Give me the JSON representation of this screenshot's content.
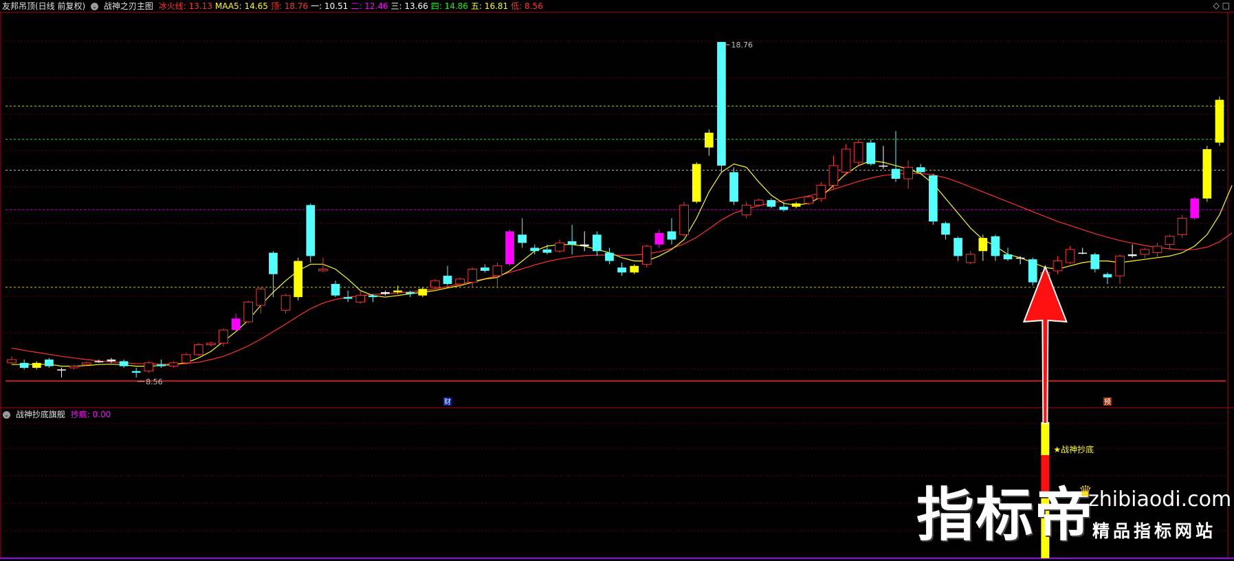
{
  "main_header": {
    "stock_name": "友邦吊顶(日线 前复权)",
    "indicator": "战神之刃主图",
    "lines": [
      {
        "label": "冰火线:",
        "value": "13.13",
        "color": "#ff3030"
      },
      {
        "label": "MAA5:",
        "value": "14.65",
        "color": "#ffff00"
      },
      {
        "label": "顶:",
        "value": "18.76",
        "color": "#ff3030"
      },
      {
        "label": "一:",
        "value": "10.51",
        "color": "#ffffff"
      },
      {
        "label": "二:",
        "value": "12.46",
        "color": "#ff00ff"
      },
      {
        "label": "三:",
        "value": "13.66",
        "color": "#ffffff"
      },
      {
        "label": "四:",
        "value": "14.86",
        "color": "#00ff00"
      },
      {
        "label": "五:",
        "value": "16.81",
        "color": "#ffff00"
      },
      {
        "label": "低:",
        "value": "8.56",
        "color": "#ff3030"
      }
    ]
  },
  "sub_header": {
    "indicator": "战神抄底旗舰",
    "signal_label": "抄底:",
    "signal_value": "0.00"
  },
  "top_right_icons": [
    "diamond-icon",
    "square-icon"
  ],
  "chart_data": {
    "type": "candlestick",
    "ylim": [
      7.7,
      19.2
    ],
    "candles": [
      {
        "o": 9.1,
        "h": 9.2,
        "l": 8.95,
        "c": 9.0,
        "k": "r"
      },
      {
        "o": 9.0,
        "h": 9.1,
        "l": 8.8,
        "c": 8.85,
        "k": "c"
      },
      {
        "o": 8.85,
        "h": 9.05,
        "l": 8.8,
        "c": 9.0,
        "k": "y"
      },
      {
        "o": 9.1,
        "h": 9.15,
        "l": 8.85,
        "c": 8.9,
        "k": "c"
      },
      {
        "o": 8.8,
        "h": 8.85,
        "l": 8.56,
        "c": 8.78,
        "k": "w"
      },
      {
        "o": 8.85,
        "h": 8.95,
        "l": 8.8,
        "c": 8.9,
        "k": "r"
      },
      {
        "o": 8.95,
        "h": 9.05,
        "l": 8.9,
        "c": 9.0,
        "k": "r"
      },
      {
        "o": 9.05,
        "h": 9.1,
        "l": 9.0,
        "c": 9.05,
        "k": "w"
      },
      {
        "o": 9.05,
        "h": 9.15,
        "l": 9.0,
        "c": 9.1,
        "k": "w"
      },
      {
        "o": 9.05,
        "h": 9.1,
        "l": 8.85,
        "c": 8.9,
        "k": "c"
      },
      {
        "o": 8.75,
        "h": 8.85,
        "l": 8.56,
        "c": 8.7,
        "k": "c"
      },
      {
        "o": 8.75,
        "h": 9.05,
        "l": 8.7,
        "c": 9.0,
        "k": "r"
      },
      {
        "o": 8.95,
        "h": 9.1,
        "l": 8.85,
        "c": 8.9,
        "k": "c"
      },
      {
        "o": 8.9,
        "h": 9.05,
        "l": 8.85,
        "c": 9.0,
        "k": "r"
      },
      {
        "o": 9.0,
        "h": 9.3,
        "l": 8.95,
        "c": 9.25,
        "k": "r"
      },
      {
        "o": 9.25,
        "h": 9.6,
        "l": 9.2,
        "c": 9.55,
        "k": "r"
      },
      {
        "o": 9.55,
        "h": 9.65,
        "l": 9.5,
        "c": 9.6,
        "k": "r"
      },
      {
        "o": 9.6,
        "h": 10.05,
        "l": 9.5,
        "c": 10.0,
        "k": "r"
      },
      {
        "o": 10.35,
        "h": 10.5,
        "l": 9.95,
        "c": 10.0,
        "k": "m"
      },
      {
        "o": 10.25,
        "h": 10.9,
        "l": 10.2,
        "c": 10.85,
        "k": "r"
      },
      {
        "o": 10.75,
        "h": 11.3,
        "l": 10.5,
        "c": 11.25,
        "k": "r"
      },
      {
        "o": 12.35,
        "h": 12.4,
        "l": 11.0,
        "c": 11.7,
        "k": "c"
      },
      {
        "o": 10.6,
        "h": 11.1,
        "l": 10.5,
        "c": 11.05,
        "k": "r"
      },
      {
        "o": 11.0,
        "h": 12.2,
        "l": 10.9,
        "c": 12.1,
        "k": "y"
      },
      {
        "o": 13.8,
        "h": 13.85,
        "l": 12.05,
        "c": 12.25,
        "k": "c"
      },
      {
        "o": 11.8,
        "h": 12.2,
        "l": 11.75,
        "c": 11.85,
        "k": "r"
      },
      {
        "o": 11.4,
        "h": 11.5,
        "l": 11.0,
        "c": 11.05,
        "k": "c"
      },
      {
        "o": 11.0,
        "h": 11.2,
        "l": 10.85,
        "c": 10.95,
        "k": "c"
      },
      {
        "o": 10.85,
        "h": 11.2,
        "l": 10.8,
        "c": 11.05,
        "k": "r"
      },
      {
        "o": 11.05,
        "h": 11.1,
        "l": 10.85,
        "c": 11.0,
        "k": "c"
      },
      {
        "o": 11.1,
        "h": 11.2,
        "l": 11.05,
        "c": 11.15,
        "k": "w"
      },
      {
        "o": 11.15,
        "h": 11.35,
        "l": 11.1,
        "c": 11.2,
        "k": "y"
      },
      {
        "o": 11.15,
        "h": 11.2,
        "l": 11.0,
        "c": 11.1,
        "k": "c"
      },
      {
        "o": 11.05,
        "h": 11.3,
        "l": 11.0,
        "c": 11.25,
        "k": "y"
      },
      {
        "o": 11.3,
        "h": 11.55,
        "l": 11.25,
        "c": 11.5,
        "k": "r"
      },
      {
        "o": 11.65,
        "h": 11.95,
        "l": 11.35,
        "c": 11.4,
        "k": "c"
      },
      {
        "o": 11.4,
        "h": 11.6,
        "l": 11.3,
        "c": 11.55,
        "k": "r"
      },
      {
        "o": 11.45,
        "h": 11.9,
        "l": 11.3,
        "c": 11.85,
        "k": "r"
      },
      {
        "o": 11.9,
        "h": 12.0,
        "l": 11.75,
        "c": 11.8,
        "k": "c"
      },
      {
        "o": 11.65,
        "h": 12.05,
        "l": 11.3,
        "c": 11.95,
        "k": "r"
      },
      {
        "o": 13.0,
        "h": 13.05,
        "l": 11.95,
        "c": 12.0,
        "k": "m"
      },
      {
        "o": 12.9,
        "h": 13.4,
        "l": 12.5,
        "c": 12.65,
        "k": "c"
      },
      {
        "o": 12.4,
        "h": 12.6,
        "l": 12.3,
        "c": 12.5,
        "k": "c"
      },
      {
        "o": 12.45,
        "h": 12.6,
        "l": 12.3,
        "c": 12.35,
        "k": "c"
      },
      {
        "o": 12.4,
        "h": 12.75,
        "l": 12.35,
        "c": 12.65,
        "k": "r"
      },
      {
        "o": 12.7,
        "h": 13.2,
        "l": 12.3,
        "c": 12.6,
        "k": "c"
      },
      {
        "o": 12.55,
        "h": 13.0,
        "l": 12.4,
        "c": 12.6,
        "k": "w"
      },
      {
        "o": 12.9,
        "h": 13.0,
        "l": 12.25,
        "c": 12.4,
        "k": "c"
      },
      {
        "o": 12.35,
        "h": 12.5,
        "l": 12.0,
        "c": 12.1,
        "k": "c"
      },
      {
        "o": 11.9,
        "h": 12.05,
        "l": 11.65,
        "c": 11.75,
        "k": "c"
      },
      {
        "o": 11.75,
        "h": 12.0,
        "l": 11.7,
        "c": 11.95,
        "k": "y"
      },
      {
        "o": 12.0,
        "h": 12.6,
        "l": 11.9,
        "c": 12.55,
        "k": "r"
      },
      {
        "o": 12.6,
        "h": 13.05,
        "l": 12.5,
        "c": 12.95,
        "k": "m"
      },
      {
        "o": 12.75,
        "h": 13.4,
        "l": 12.6,
        "c": 13.0,
        "k": "c"
      },
      {
        "o": 12.9,
        "h": 13.9,
        "l": 12.85,
        "c": 13.8,
        "k": "r"
      },
      {
        "o": 13.9,
        "h": 15.1,
        "l": 13.85,
        "c": 15.05,
        "k": "y"
      },
      {
        "o": 16.0,
        "h": 16.1,
        "l": 15.3,
        "c": 15.55,
        "k": "y"
      },
      {
        "o": 18.76,
        "h": 18.76,
        "l": 14.8,
        "c": 15.0,
        "k": "c"
      },
      {
        "o": 14.8,
        "h": 14.95,
        "l": 13.8,
        "c": 13.9,
        "k": "c"
      },
      {
        "o": 13.5,
        "h": 13.9,
        "l": 13.4,
        "c": 13.8,
        "k": "r"
      },
      {
        "o": 13.8,
        "h": 14.0,
        "l": 13.75,
        "c": 13.95,
        "k": "r"
      },
      {
        "o": 13.95,
        "h": 14.0,
        "l": 13.7,
        "c": 13.75,
        "k": "c"
      },
      {
        "o": 13.75,
        "h": 13.9,
        "l": 13.6,
        "c": 13.65,
        "k": "c"
      },
      {
        "o": 13.75,
        "h": 13.9,
        "l": 13.7,
        "c": 13.85,
        "k": "y"
      },
      {
        "o": 13.85,
        "h": 14.1,
        "l": 13.8,
        "c": 14.05,
        "k": "r"
      },
      {
        "o": 14.0,
        "h": 14.5,
        "l": 13.9,
        "c": 14.4,
        "k": "r"
      },
      {
        "o": 14.4,
        "h": 15.3,
        "l": 14.3,
        "c": 15.0,
        "k": "r"
      },
      {
        "o": 14.8,
        "h": 15.65,
        "l": 14.7,
        "c": 15.5,
        "k": "r"
      },
      {
        "o": 15.1,
        "h": 15.8,
        "l": 15.0,
        "c": 15.7,
        "k": "r"
      },
      {
        "o": 15.7,
        "h": 15.8,
        "l": 15.0,
        "c": 15.05,
        "k": "c"
      },
      {
        "o": 15.0,
        "h": 15.6,
        "l": 14.9,
        "c": 15.0,
        "k": "w"
      },
      {
        "o": 14.9,
        "h": 16.05,
        "l": 14.5,
        "c": 14.6,
        "k": "c"
      },
      {
        "o": 14.6,
        "h": 15.15,
        "l": 14.3,
        "c": 14.95,
        "k": "r"
      },
      {
        "o": 14.95,
        "h": 15.05,
        "l": 14.75,
        "c": 14.8,
        "k": "c"
      },
      {
        "o": 14.7,
        "h": 14.75,
        "l": 13.2,
        "c": 13.3,
        "k": "c"
      },
      {
        "o": 13.25,
        "h": 13.3,
        "l": 12.75,
        "c": 12.9,
        "k": "c"
      },
      {
        "o": 12.8,
        "h": 12.85,
        "l": 12.1,
        "c": 12.25,
        "k": "c"
      },
      {
        "o": 12.05,
        "h": 12.4,
        "l": 12.0,
        "c": 12.3,
        "k": "r"
      },
      {
        "o": 12.4,
        "h": 12.9,
        "l": 12.1,
        "c": 12.8,
        "k": "y"
      },
      {
        "o": 12.85,
        "h": 12.9,
        "l": 12.1,
        "c": 12.25,
        "k": "c"
      },
      {
        "o": 12.3,
        "h": 12.5,
        "l": 12.1,
        "c": 12.15,
        "k": "c"
      },
      {
        "o": 12.2,
        "h": 12.25,
        "l": 12.0,
        "c": 12.2,
        "k": "w"
      },
      {
        "o": 12.15,
        "h": 12.2,
        "l": 11.35,
        "c": 11.45,
        "k": "c"
      },
      {
        "o": 11.6,
        "h": 11.8,
        "l": 11.3,
        "c": 11.75,
        "k": "r"
      },
      {
        "o": 11.8,
        "h": 12.25,
        "l": 11.7,
        "c": 12.1,
        "k": "r"
      },
      {
        "o": 12.05,
        "h": 12.55,
        "l": 12.0,
        "c": 12.45,
        "k": "r"
      },
      {
        "o": 12.35,
        "h": 12.5,
        "l": 12.3,
        "c": 12.35,
        "k": "w"
      },
      {
        "o": 12.3,
        "h": 12.35,
        "l": 11.75,
        "c": 11.85,
        "k": "c"
      },
      {
        "o": 11.7,
        "h": 11.75,
        "l": 11.4,
        "c": 11.6,
        "k": "c"
      },
      {
        "o": 11.65,
        "h": 12.3,
        "l": 11.4,
        "c": 12.25,
        "k": "r"
      },
      {
        "o": 12.25,
        "h": 12.6,
        "l": 12.2,
        "c": 12.3,
        "k": "w"
      },
      {
        "o": 12.3,
        "h": 12.5,
        "l": 12.2,
        "c": 12.45,
        "k": "r"
      },
      {
        "o": 12.35,
        "h": 12.65,
        "l": 12.2,
        "c": 12.55,
        "k": "r"
      },
      {
        "o": 12.6,
        "h": 12.9,
        "l": 12.45,
        "c": 12.85,
        "k": "r"
      },
      {
        "o": 12.9,
        "h": 13.5,
        "l": 12.8,
        "c": 13.4,
        "k": "r"
      },
      {
        "o": 13.4,
        "h": 14.05,
        "l": 13.35,
        "c": 14.0,
        "k": "m"
      },
      {
        "o": 14.0,
        "h": 15.6,
        "l": 13.9,
        "c": 15.5,
        "k": "y"
      },
      {
        "o": 15.7,
        "h": 17.1,
        "l": 15.6,
        "c": 17.0,
        "k": "y"
      }
    ],
    "ma_yellow": [
      8.95,
      8.95,
      8.95,
      8.96,
      8.9,
      8.9,
      8.92,
      8.95,
      8.96,
      8.94,
      8.9,
      8.9,
      8.92,
      8.95,
      9.0,
      9.15,
      9.35,
      9.65,
      9.95,
      10.3,
      10.75,
      11.15,
      11.5,
      11.8,
      12.0,
      12.0,
      11.85,
      11.55,
      11.2,
      11.05,
      11.0,
      11.05,
      11.1,
      11.15,
      11.2,
      11.28,
      11.35,
      11.45,
      11.55,
      11.6,
      11.8,
      12.1,
      12.4,
      12.55,
      12.6,
      12.6,
      12.55,
      12.45,
      12.35,
      12.2,
      12.1,
      12.1,
      12.25,
      12.45,
      12.75,
      13.4,
      14.2,
      14.8,
      15.05,
      14.95,
      14.5,
      14.1,
      13.85,
      13.8,
      13.85,
      14.05,
      14.4,
      14.75,
      15.0,
      15.15,
      15.1,
      15.0,
      14.9,
      14.75,
      14.45,
      14.0,
      13.55,
      13.1,
      12.75,
      12.55,
      12.3,
      12.2,
      12.05,
      11.9,
      11.85,
      11.95,
      12.05,
      12.1,
      12.1,
      12.05,
      12.1,
      12.15,
      12.2,
      12.25,
      12.35,
      12.55,
      12.9,
      13.5,
      14.4
    ],
    "ma_red": [
      9.45,
      9.38,
      9.32,
      9.26,
      9.2,
      9.15,
      9.1,
      9.06,
      9.03,
      9.0,
      8.98,
      8.97,
      8.96,
      8.96,
      8.98,
      9.02,
      9.1,
      9.2,
      9.35,
      9.52,
      9.72,
      9.95,
      10.18,
      10.42,
      10.65,
      10.82,
      10.93,
      11.0,
      11.04,
      11.08,
      11.1,
      11.13,
      11.16,
      11.2,
      11.25,
      11.32,
      11.4,
      11.48,
      11.56,
      11.65,
      11.75,
      11.86,
      11.98,
      12.08,
      12.16,
      12.22,
      12.26,
      12.28,
      12.28,
      12.27,
      12.28,
      12.31,
      12.38,
      12.48,
      12.62,
      12.82,
      13.08,
      13.35,
      13.55,
      13.68,
      13.78,
      13.86,
      13.93,
      14.0,
      14.08,
      14.17,
      14.28,
      14.4,
      14.52,
      14.62,
      14.7,
      14.74,
      14.76,
      14.76,
      14.72,
      14.63,
      14.5,
      14.35,
      14.2,
      14.05,
      13.9,
      13.75,
      13.6,
      13.45,
      13.3,
      13.18,
      13.05,
      12.93,
      12.82,
      12.72,
      12.64,
      12.57,
      12.51,
      12.47,
      12.44,
      12.45,
      12.52,
      12.68,
      12.95
    ],
    "hlines": [
      {
        "v": 16.81,
        "color": "#c8c800"
      },
      {
        "v": 15.8,
        "color": "#40c040"
      },
      {
        "v": 14.86,
        "color": "#c0c0c0"
      },
      {
        "v": 13.66,
        "color": "#c000c0"
      },
      {
        "v": 11.3,
        "color": "#c8c800"
      }
    ],
    "low_line": 8.45,
    "annotations": [
      {
        "text": "18.76",
        "idx": 57,
        "v": 18.76
      },
      {
        "text": "8.56",
        "idx": 10,
        "v": 8.56
      }
    ],
    "markers": [
      {
        "text": "财",
        "idx": 35
      },
      {
        "text": "预",
        "idx": 88
      }
    ],
    "signal_bar_idx": 83,
    "signal_label": "★战神抄底"
  },
  "watermark": {
    "cn": "指标帝",
    "url": "zhibiaodi.com",
    "sub": "精品指标网站"
  },
  "colors": {
    "up": "#ff3232",
    "down": "#54ffff",
    "flat": "#ffffff",
    "hot": "#ffff00",
    "magenta": "#ff00ff"
  }
}
